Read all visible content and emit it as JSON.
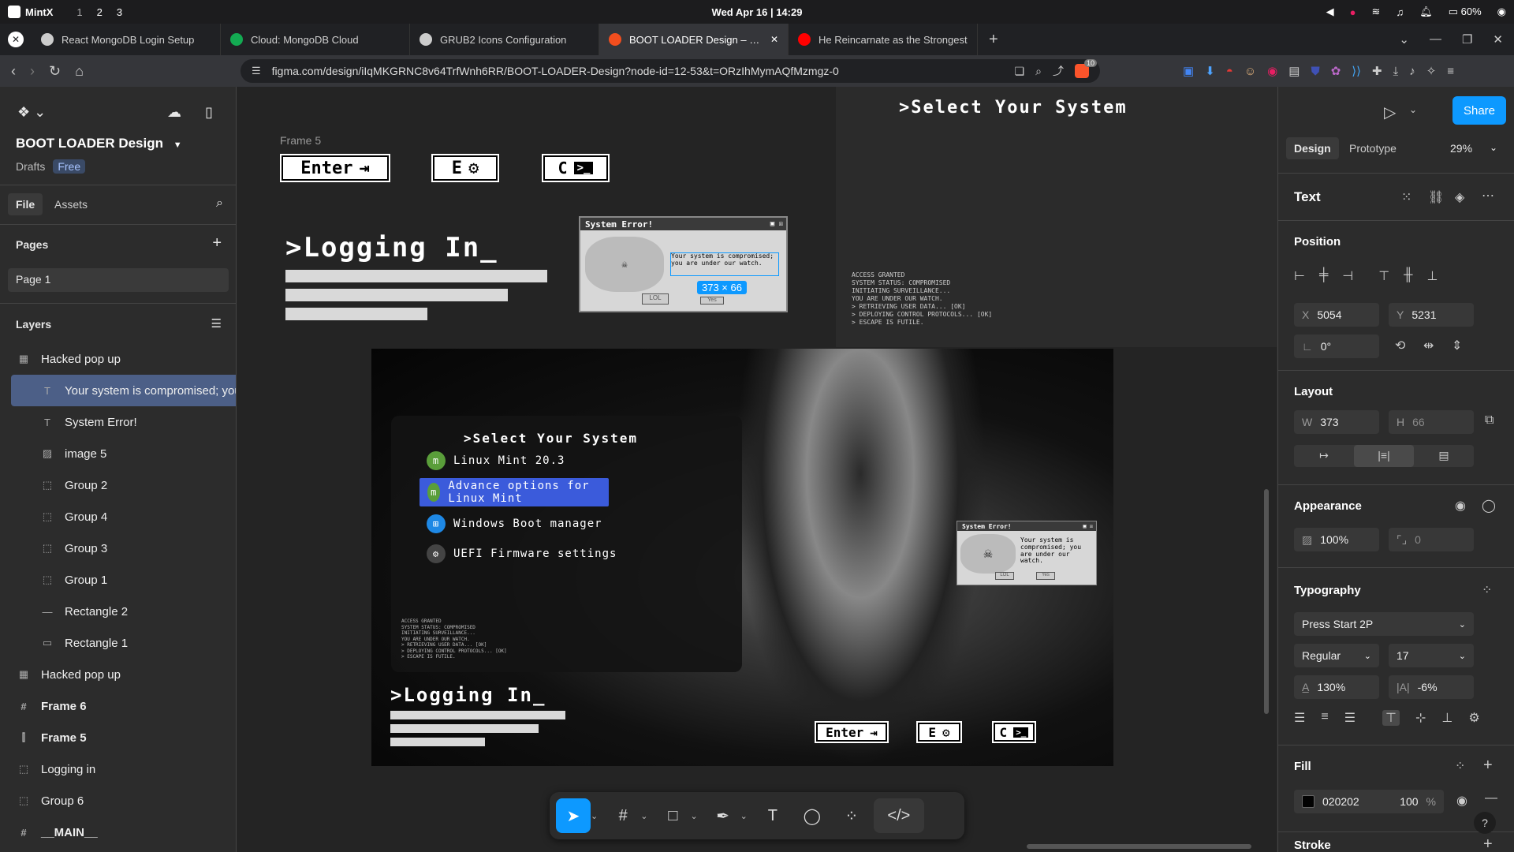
{
  "system": {
    "distro": "MintX",
    "workspaces": [
      "1",
      "2",
      "3"
    ],
    "clock": "Wed Apr 16 | 14:29",
    "battery": "60%"
  },
  "tabs": [
    {
      "title": "React MongoDB Login Setup",
      "icon": "openai-icon",
      "color": "#cccccc"
    },
    {
      "title": "Cloud: MongoDB Cloud",
      "icon": "mongodb-leaf-icon",
      "color": "#13aa52"
    },
    {
      "title": "GRUB2 Icons Configuration",
      "icon": "openai-icon",
      "color": "#cccccc"
    },
    {
      "title": "BOOT LOADER Design – Figma",
      "icon": "figma-icon",
      "color": "#f24e1e",
      "active": true
    },
    {
      "title": "He Reincarnate as the Strongest",
      "icon": "youtube-icon",
      "color": "#ff0000"
    }
  ],
  "address": {
    "url": "figma.com/design/iIqMKGRNC8v64TrfWnh6RR/BOOT-LOADER-Design?node-id=12-53&t=ORzIhMymAQfMzmgz-0",
    "brave_count": "10"
  },
  "left": {
    "file_name": "BOOT LOADER Design",
    "drafts": "Drafts",
    "plan": "Free",
    "tab_file": "File",
    "tab_assets": "Assets",
    "pages_title": "Pages",
    "page1": "Page 1",
    "layers_title": "Layers",
    "layers": [
      {
        "name": "Hacked pop up",
        "icon": "▦",
        "sub": false
      },
      {
        "name": "Your system is compromised; you",
        "icon": "T",
        "sub": true,
        "sel": true
      },
      {
        "name": "System Error!",
        "icon": "T",
        "sub": true
      },
      {
        "name": "image 5",
        "icon": "▨",
        "sub": true
      },
      {
        "name": "Group 2",
        "icon": "⬚",
        "sub": true
      },
      {
        "name": "Group 4",
        "icon": "⬚",
        "sub": true
      },
      {
        "name": "Group 3",
        "icon": "⬚",
        "sub": true
      },
      {
        "name": "Group 1",
        "icon": "⬚",
        "sub": true
      },
      {
        "name": "Rectangle 2",
        "icon": "—",
        "sub": true
      },
      {
        "name": "Rectangle 1",
        "icon": "▭",
        "sub": true
      },
      {
        "name": "Hacked pop up",
        "icon": "▦",
        "sub": false
      },
      {
        "name": "Frame 6",
        "icon": "#",
        "sub": false,
        "bold": true
      },
      {
        "name": "Frame 5",
        "icon": "⫿",
        "sub": false,
        "bold": true
      },
      {
        "name": "Logging in",
        "icon": "⬚",
        "sub": false
      },
      {
        "name": "Group 6",
        "icon": "⬚",
        "sub": false
      },
      {
        "name": "__MAIN__",
        "icon": "#",
        "sub": false,
        "bold": true
      }
    ]
  },
  "canvas": {
    "frame5_label": "Frame 5",
    "key_enter": "Enter",
    "key_e": "E",
    "key_c": "C",
    "logging_title": ">Logging In_",
    "error_title": "System Error!",
    "error_msg": "Your system is compromised; you are under our watch.",
    "error_btn1": "LOL",
    "error_btn2": "Yes",
    "selection_size": "373 × 66",
    "select_title": ">Select Your System",
    "log_lines": "ACCESS GRANTED\nSYSTEM STATUS: COMPROMISED\nINITIATING SURVEILLANCE...\nYOU ARE UNDER OUR WATCH.\n> RETRIEVING USER DATA... [OK]\n> DEPLOYING CONTROL PROTOCOLS... [OK]\n> ESCAPE IS FUTILE.",
    "menu": [
      {
        "label": "Linux Mint 20.3",
        "icon": "mint-logo-icon",
        "color": "#5a9e3a"
      },
      {
        "label": "Advance options for Linux Mint",
        "icon": "mint-logo-icon",
        "color": "#5a9e3a",
        "selected": true
      },
      {
        "label": "Windows Boot manager",
        "icon": "windows-logo-icon",
        "color": "#1e88e5"
      },
      {
        "label": "UEFI Firmware settings",
        "icon": "gear-icon",
        "color": "#444444"
      }
    ]
  },
  "right": {
    "share": "Share",
    "tab_design": "Design",
    "tab_prototype": "Prototype",
    "zoom": "29%",
    "sel_type": "Text",
    "position_title": "Position",
    "x_label": "X",
    "x": "5054",
    "y_label": "Y",
    "y": "5231",
    "rotation": "0°",
    "layout_title": "Layout",
    "w_label": "W",
    "w": "373",
    "h_label": "H",
    "h": "66",
    "appearance_title": "Appearance",
    "opacity": "100%",
    "radius": "0",
    "typography_title": "Typography",
    "font": "Press Start 2P",
    "weight": "Regular",
    "size": "17",
    "line_height": "130%",
    "letter_spacing": "-6%",
    "fill_title": "Fill",
    "fill_hex": "020202",
    "fill_opacity": "100",
    "fill_unit": "%",
    "stroke_title": "Stroke"
  },
  "colors": {
    "accent": "#0d99ff",
    "selection": "#4c5f87",
    "menu_sel": "#3b5bdb"
  }
}
